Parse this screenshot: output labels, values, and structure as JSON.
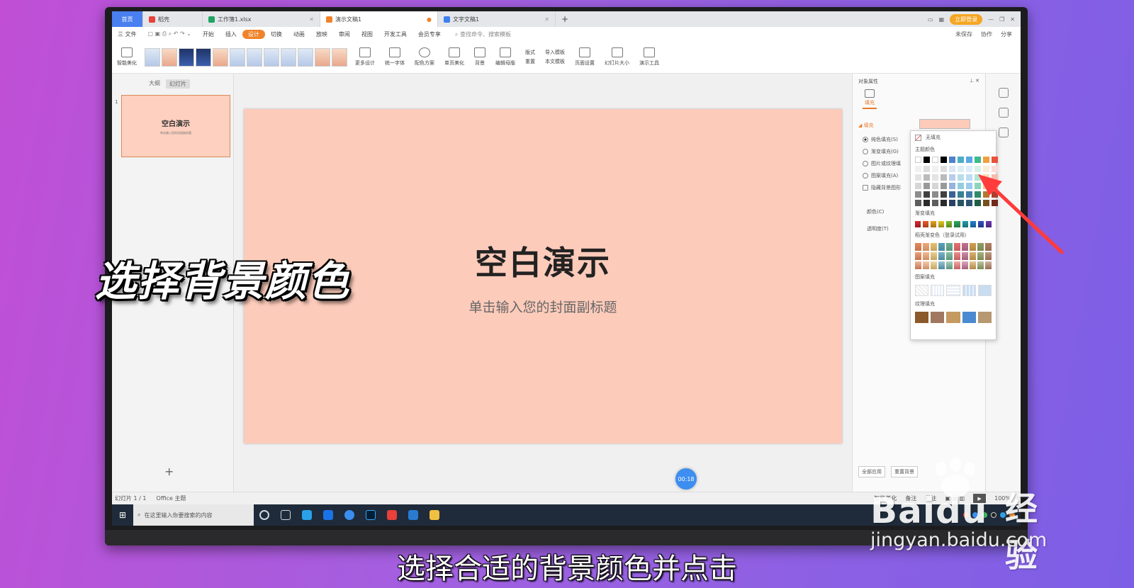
{
  "tabs": [
    {
      "label": "首页",
      "type": "home"
    },
    {
      "label": "稻壳",
      "color": "#e8403a"
    },
    {
      "label": "工作簿1.xlsx",
      "color": "#1fa463"
    },
    {
      "label": "演示文稿1",
      "color": "#f0832a",
      "active": true
    },
    {
      "label": "文字文稿1",
      "color": "#3d7ef0"
    }
  ],
  "login_label": "立即登录",
  "menu": {
    "file_label": "三 文件",
    "items": [
      "开始",
      "插入",
      "设计",
      "切换",
      "动画",
      "放映",
      "审阅",
      "视图",
      "开发工具",
      "会员专享"
    ],
    "selected_index": 2,
    "search_placeholder": "查找命令、搜索模板",
    "unsaved": "未保存",
    "collab": "协作",
    "share": "分享"
  },
  "ribbon": {
    "smart": "智能美化",
    "more_design": "更多设计",
    "unify_font": "统一字体",
    "color_scheme": "配色方案",
    "single_page": "单页美化",
    "background": "背景",
    "edit_master": "编辑母版",
    "layout": "版式",
    "reset": "重置",
    "import_template": "导入模板",
    "this_template": "本文模板",
    "page_setup": "页面设置",
    "slide_size": "幻灯片大小",
    "present_tools": "演示工具"
  },
  "left_panel": {
    "tab_outline": "大纲",
    "tab_slides": "幻灯片",
    "slide_number": "1",
    "thumb_title": "空白演示",
    "thumb_sub": "单击输入您的封面副标题",
    "add": "+"
  },
  "slide": {
    "title": "空白演示",
    "subtitle": "单击输入您的封面副标题",
    "bg_color": "#fdcbba"
  },
  "timer": "00:18",
  "right_pane": {
    "title": "对象属性",
    "fill_tab": "填充",
    "section": "填充",
    "radios": [
      "纯色填充(S)",
      "渐变填充(G)",
      "图片或纹理填",
      "图案填充(A)",
      "隐藏背景图形"
    ],
    "selected_radio": 0,
    "color_label": "颜色(C)",
    "transparency_label": "透明度(T)",
    "apply_all": "全部应用",
    "reset_bg": "重置背景"
  },
  "popup": {
    "no_fill": "无填充",
    "theme_colors": "主题颜色",
    "theme_row": [
      "#ffffff",
      "#000000",
      "#ffffff",
      "#000000",
      "#4f81c7",
      "#4bacc6",
      "#5aa6e6",
      "#3dbb8c",
      "#f0a040",
      "#e8523a"
    ],
    "gradient_fill": "渐变填充",
    "gradient_row": [
      "#d82a2a",
      "#e85a2a",
      "#e8a020",
      "#e0c820",
      "#80c030",
      "#30a860",
      "#20a0a8",
      "#2080d0",
      "#3050c0",
      "#6a38b0"
    ],
    "docer_gradient": "稻壳渐变色（登录试用）",
    "pattern_fill": "图案填充",
    "texture_fill": "纹理填充"
  },
  "statusbar": {
    "slide_info": "幻灯片 1 / 1",
    "theme": "Office 主题",
    "smart": "智能美化",
    "notes": "备注",
    "comments": "批注",
    "zoom": "100%"
  },
  "taskbar": {
    "search_placeholder": "在这里输入你要搜索的内容"
  },
  "overlay": {
    "big_caption": "选择背景颜色",
    "subtitle": "选择合适的背景颜色并点击"
  },
  "watermark": {
    "brand": "Baidu",
    "cn": "经验",
    "url": "jingyan.baidu.com"
  }
}
